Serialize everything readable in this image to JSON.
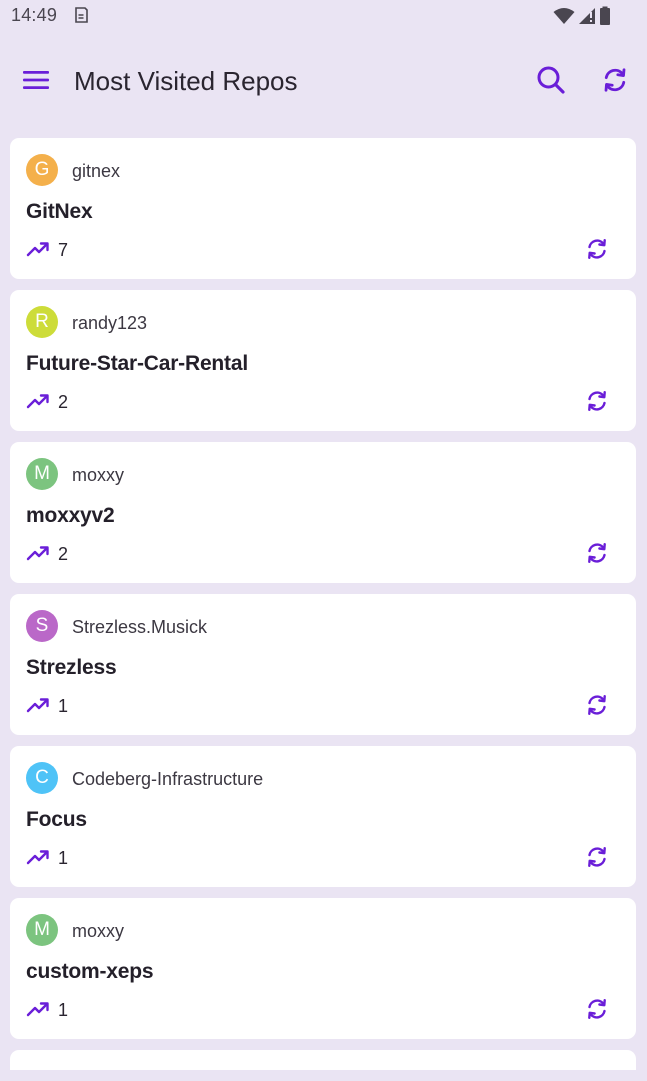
{
  "status_bar": {
    "time": "14:49"
  },
  "app_bar": {
    "title": "Most Visited Repos",
    "icons": [
      "menu-icon",
      "search-icon",
      "refresh-icon"
    ]
  },
  "colors": {
    "accent": "#6A1ED8",
    "background": "#EAE4F3",
    "card": "#FFFFFF"
  },
  "repos": [
    {
      "initial": "G",
      "avatar_color": "#F4B04B",
      "owner": "gitnex",
      "name": "GitNex",
      "visits": "7"
    },
    {
      "initial": "R",
      "avatar_color": "#CDDC39",
      "owner": "randy123",
      "name": "Future-Star-Car-Rental",
      "visits": "2"
    },
    {
      "initial": "M",
      "avatar_color": "#7CC47F",
      "owner": "moxxy",
      "name": "moxxyv2",
      "visits": "2"
    },
    {
      "initial": "S",
      "avatar_color": "#BA68C8",
      "owner": "Strezless.Musick",
      "name": "Strezless",
      "visits": "1"
    },
    {
      "initial": "C",
      "avatar_color": "#4FC3F7",
      "owner": "Codeberg-Infrastructure",
      "name": "Focus",
      "visits": "1"
    },
    {
      "initial": "M",
      "avatar_color": "#7CC47F",
      "owner": "moxxy",
      "name": "custom-xeps",
      "visits": "1"
    }
  ]
}
